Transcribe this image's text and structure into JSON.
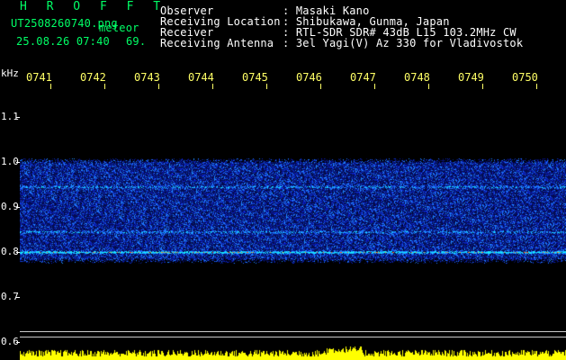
{
  "header": {
    "station": "H R O F F T",
    "filename": "UT2508260740.png",
    "tag": "meteor",
    "datetime": "25.08.26 07:40",
    "count": "69."
  },
  "info": {
    "labels": [
      "Observer",
      "Receiving Location",
      "Receiver",
      "Receiving Antenna"
    ],
    "values": [
      ": Masaki Kano",
      ": Shibukawa, Gunma, Japan",
      ": RTL-SDR SDR# 43dB L15 103.2MHz CW",
      ": 3el Yagi(V) Az 330 for Vladivostok"
    ]
  },
  "axis": {
    "unit": "kHz",
    "y_ticks": [
      "1.1",
      "1.0",
      "0.9",
      "0.8",
      "0.7",
      "0.6"
    ],
    "x_ticks": [
      "0741",
      "0742",
      "0743",
      "0744",
      "0745",
      "0746",
      "0747",
      "0748",
      "0749",
      "0750"
    ]
  },
  "spectrogram": {
    "freq_range_khz": [
      0.6,
      1.1
    ],
    "band_khz": [
      0.775,
      1.01
    ],
    "bright_lines_khz": [
      0.945,
      0.845,
      0.8
    ],
    "colors": {
      "background": "#000000",
      "signal_low": "#0a1a9a",
      "signal_mid": "#1f5fff",
      "signal_high": "#00e5ff",
      "hot": "#ff3010",
      "activity": "#ffff00"
    }
  }
}
